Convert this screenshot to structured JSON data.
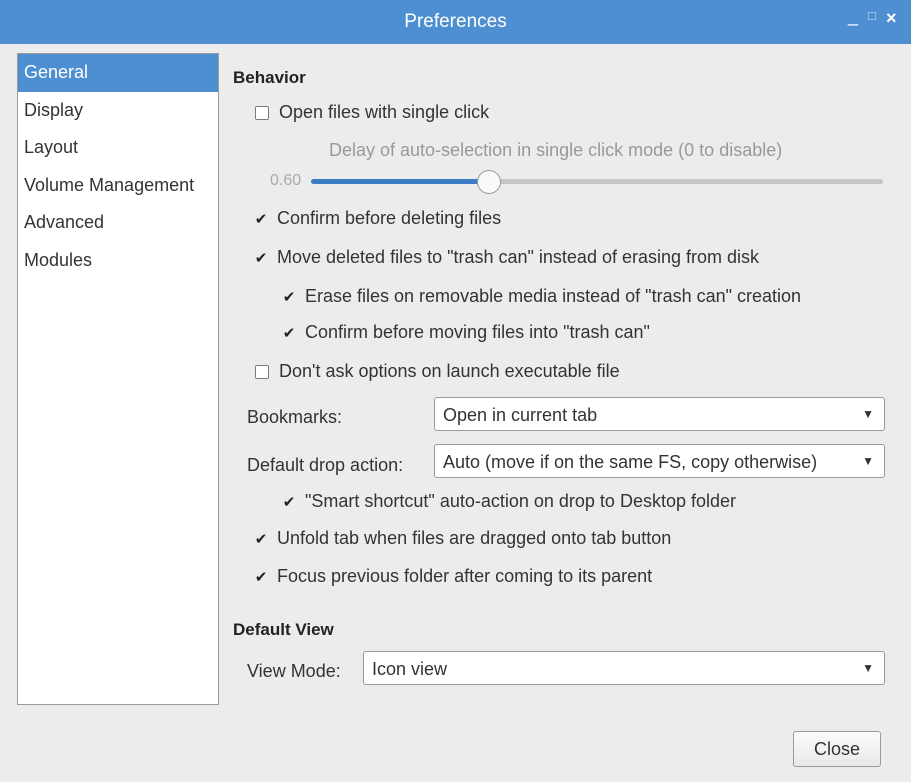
{
  "window": {
    "title": "Preferences",
    "controls": {
      "minimize": "_",
      "maximize": "□",
      "close": "×"
    }
  },
  "sidebar": {
    "items": [
      {
        "label": "General",
        "selected": true
      },
      {
        "label": "Display",
        "selected": false
      },
      {
        "label": "Layout",
        "selected": false
      },
      {
        "label": "Volume Management",
        "selected": false
      },
      {
        "label": "Advanced",
        "selected": false
      },
      {
        "label": "Modules",
        "selected": false
      }
    ]
  },
  "behavior": {
    "title": "Behavior",
    "single_click": {
      "label": "Open files with single click",
      "checked": false
    },
    "auto_selection": {
      "caption": "Delay of auto-selection in single click mode (0 to disable)",
      "value_text": "0.60",
      "fraction": 0.31
    },
    "confirm_delete": {
      "label": "Confirm before deleting files",
      "checked": true
    },
    "move_to_trash": {
      "label": "Move deleted files to \"trash can\" instead of erasing from disk",
      "checked": true
    },
    "erase_removable": {
      "label": "Erase files on removable media instead of \"trash can\" creation",
      "checked": true
    },
    "confirm_trash": {
      "label": "Confirm before moving files into \"trash can\"",
      "checked": true
    },
    "dont_ask_exec": {
      "label": "Don't ask options on launch executable file",
      "checked": false
    },
    "bookmarks": {
      "label": "Bookmarks:",
      "value": "Open in current tab"
    },
    "drop_action": {
      "label": "Default drop action:",
      "value": "Auto (move if on the same FS, copy otherwise)"
    },
    "smart_shortcut": {
      "label": "\"Smart shortcut\" auto-action on drop to Desktop folder",
      "checked": true
    },
    "unfold_tab": {
      "label": "Unfold tab when files are dragged onto tab button",
      "checked": true
    },
    "focus_previous": {
      "label": "Focus previous folder after coming to its parent",
      "checked": true
    }
  },
  "default_view": {
    "title": "Default View",
    "view_mode": {
      "label": "View Mode:",
      "value": "Icon view"
    }
  },
  "footer": {
    "close_label": "Close"
  },
  "colors": {
    "accent": "#4d8fd0",
    "slider_fill": "#3c7cc2"
  }
}
